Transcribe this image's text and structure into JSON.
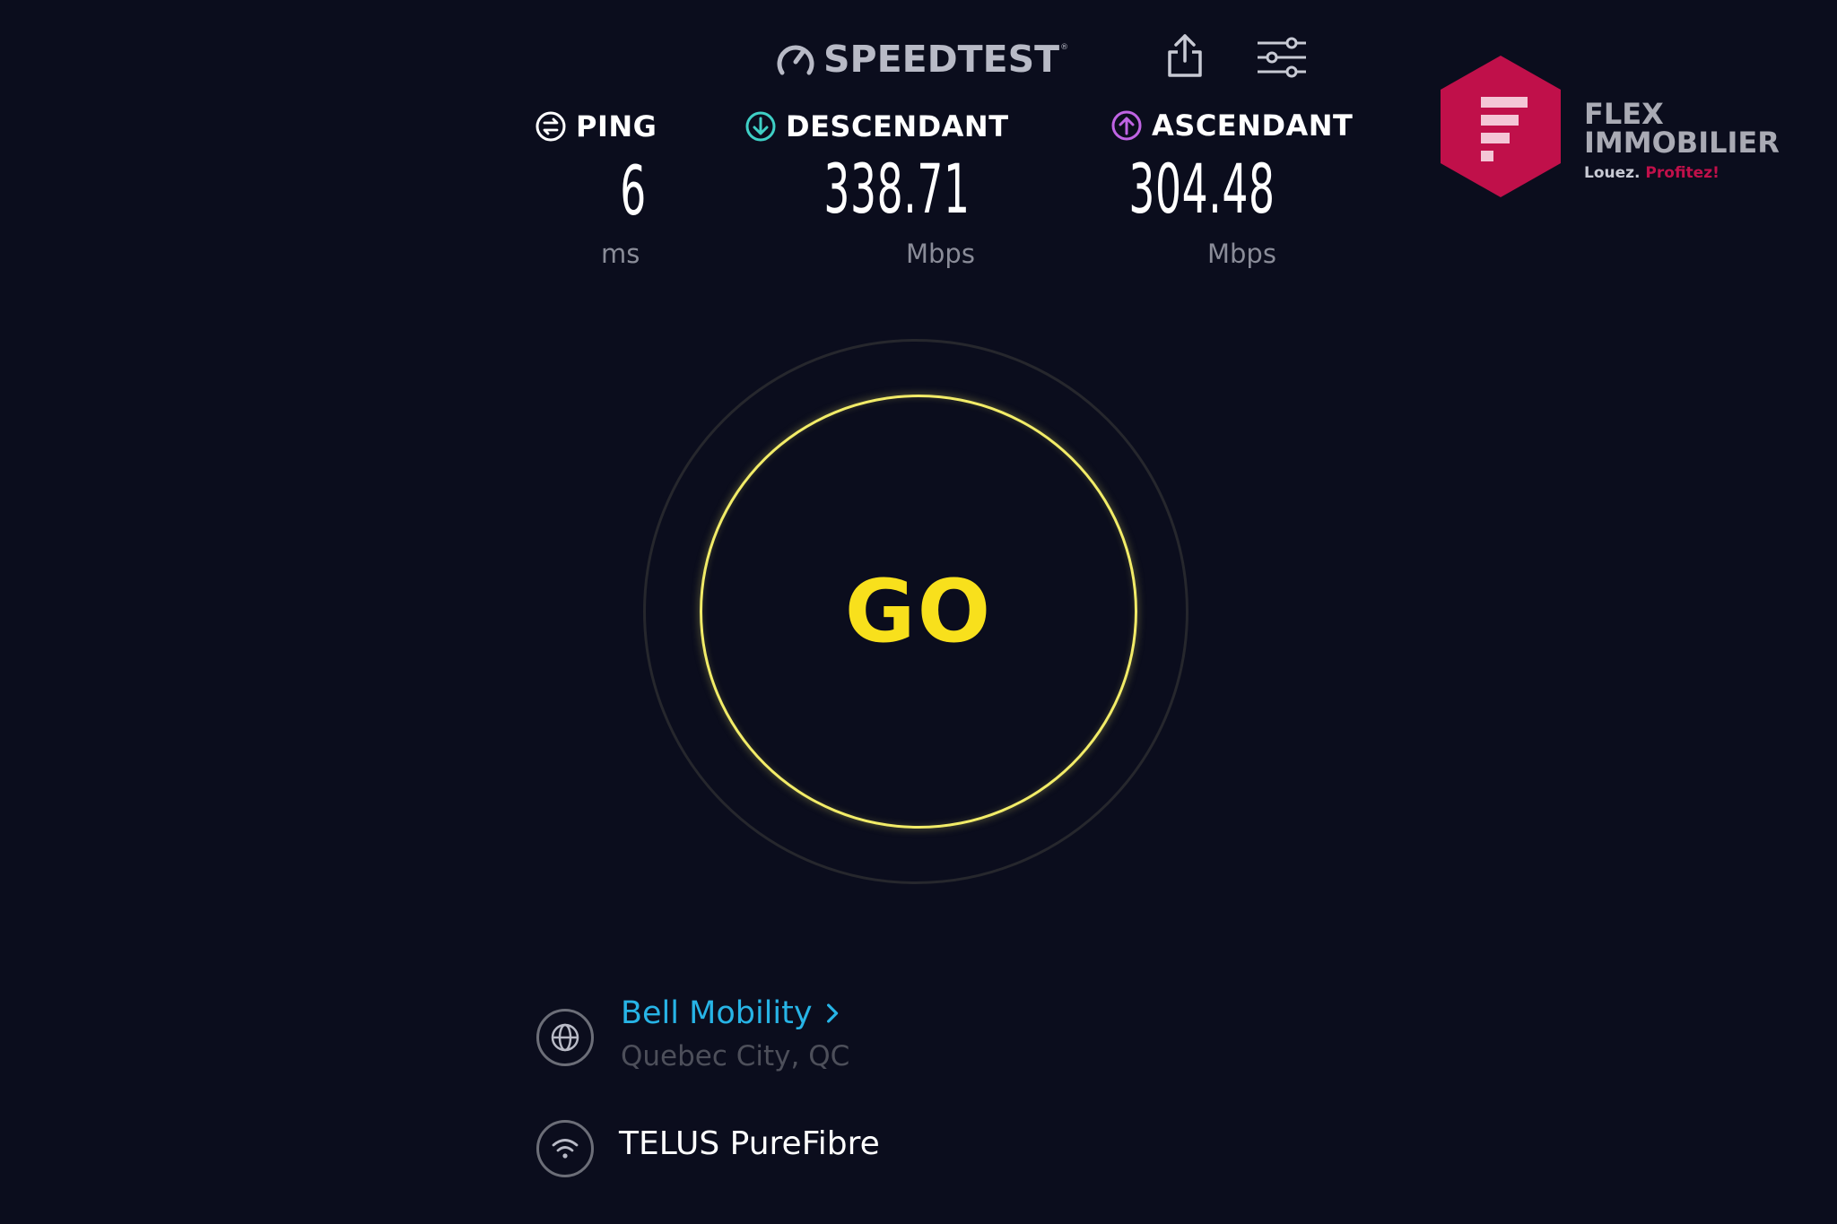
{
  "app": {
    "brand": "SPEEDTEST",
    "brand_tm": "®"
  },
  "toolbar": {
    "share_icon": "share-icon",
    "settings_icon": "sliders-icon"
  },
  "metrics": {
    "ping": {
      "label": "PING",
      "value": "6",
      "unit": "ms",
      "icon_color": "#ffffff"
    },
    "download": {
      "label": "DESCENDANT",
      "value": "338.71",
      "unit": "Mbps",
      "icon_color": "#3fd0c6"
    },
    "upload": {
      "label": "ASCENDANT",
      "value": "304.48",
      "unit": "Mbps",
      "icon_color": "#c064e4"
    }
  },
  "go_button": {
    "label": "GO",
    "color": "#f8e01c"
  },
  "server": {
    "isp": "Bell Mobility",
    "location": "Quebec City, QC",
    "icon": "globe-icon",
    "isp_color": "#27b4e6"
  },
  "connection": {
    "name": "TELUS PureFibre",
    "icon": "wifi-icon"
  },
  "watermark": {
    "line1": "FLEX",
    "line2": "IMMOBILIER",
    "tagline_a": "Louez.",
    "tagline_b": "Profitez!",
    "hex_color": "#c0104a"
  },
  "colors": {
    "background": "#0b0d1d",
    "accent_yellow": "#f8e01c"
  }
}
